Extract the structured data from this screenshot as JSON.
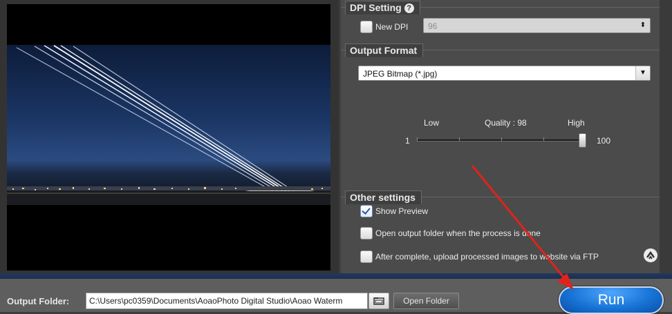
{
  "dpi_setting": {
    "title": "DPI Setting",
    "help_glyph": "?",
    "new_dpi_label": "New DPI",
    "new_dpi_checked": false,
    "dpi_value": "96"
  },
  "output_format": {
    "title": "Output Format",
    "selected": "JPEG Bitmap (*.jpg)",
    "quality": {
      "low_label": "Low",
      "high_label": "High",
      "caption": "Quality : 98",
      "min_label": "1",
      "max_label": "100",
      "value": 98,
      "min": 1,
      "max": 100
    }
  },
  "other_settings": {
    "title": "Other settings",
    "options": [
      {
        "label": "Show Preview",
        "checked": true
      },
      {
        "label": "Open output folder when the process is done",
        "checked": false
      },
      {
        "label": "After complete, upload processed images to website via FTP",
        "checked": false
      }
    ]
  },
  "bottom_bar": {
    "output_folder_label": "Output Folder:",
    "output_folder_path": "C:\\Users\\pc0359\\Documents\\AoaoPhoto Digital Studio\\Aoao Waterm",
    "open_folder_label": "Open Folder",
    "run_label": "Run"
  },
  "icons": {
    "help": "help-icon",
    "browse": "folder-browse-icon",
    "ftp_settings": "ftp-settings-icon",
    "combo_arrow": "chevron-down-icon",
    "spinner": "updown-spinner-icon"
  },
  "colors": {
    "panel_bg": "#4b4b4b",
    "run_button": "#1874d6",
    "annotation_arrow": "#e0231c"
  }
}
